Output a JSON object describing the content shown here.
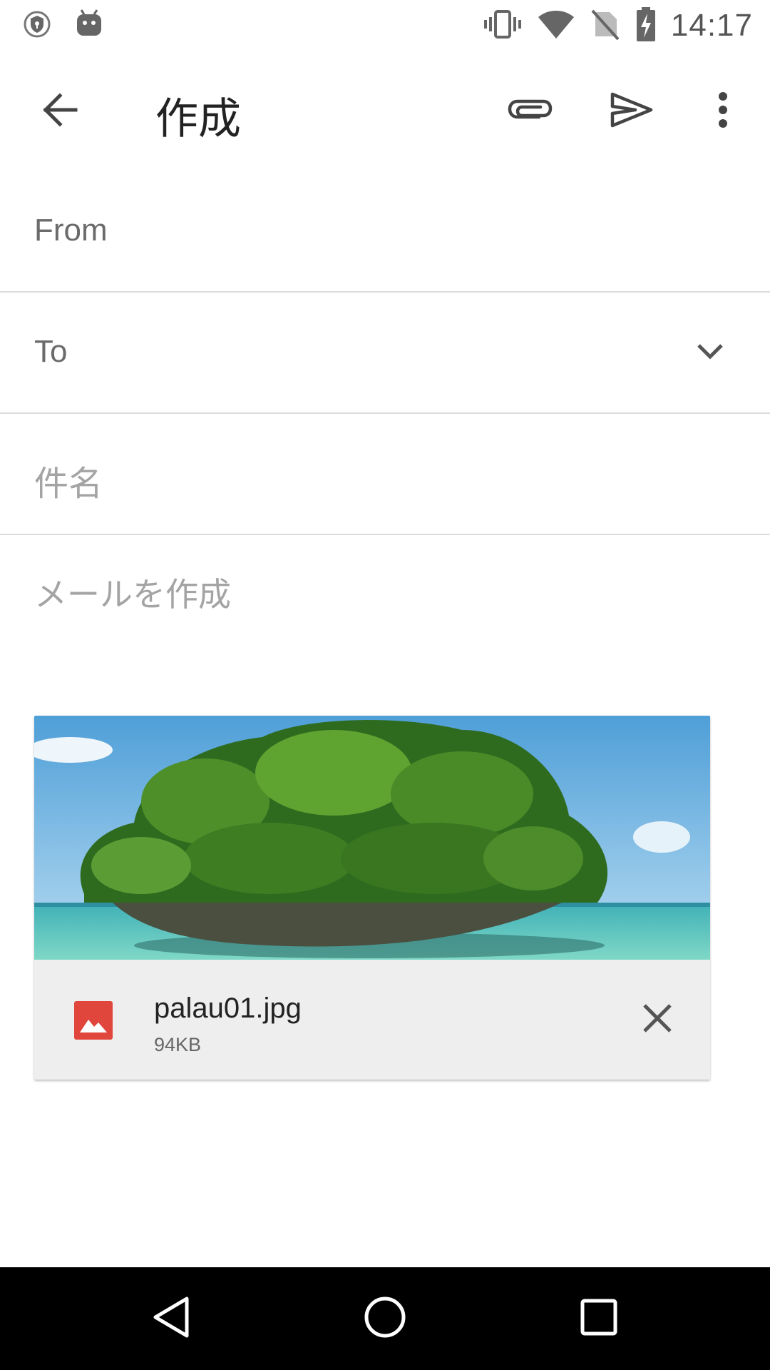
{
  "status_bar": {
    "time": "14:17",
    "left_icons": [
      "shield-badge-icon",
      "android-debug-icon"
    ],
    "right_icons": [
      "vibrate-icon",
      "wifi-icon",
      "no-sim-icon",
      "battery-charging-icon"
    ]
  },
  "toolbar": {
    "title": "作成",
    "back_icon": "arrow-back-icon",
    "attach_icon": "paperclip-icon",
    "send_icon": "send-icon",
    "more_icon": "more-vert-icon"
  },
  "compose": {
    "from_label": "From",
    "to_label": "To",
    "subject_placeholder": "件名",
    "body_placeholder": "メールを作成"
  },
  "attachment": {
    "file_name": "palau01.jpg",
    "file_size": "94KB",
    "type_icon": "image-file-icon",
    "remove_icon": "close-icon"
  },
  "colors": {
    "file_icon_red": "#e0463c",
    "divider": "#dcdcdc",
    "hint_text": "#a4a4a4"
  }
}
